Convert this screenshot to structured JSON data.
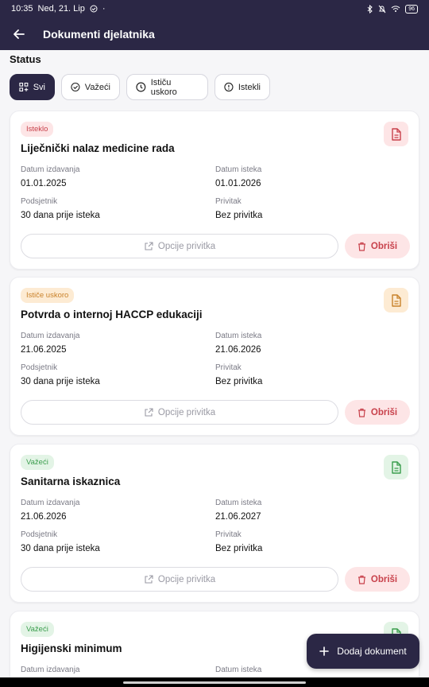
{
  "status_bar": {
    "time": "10:35",
    "date": "Ned, 21. Lip",
    "battery": "96"
  },
  "header": {
    "title": "Dokumenti djelatnika"
  },
  "status_section": {
    "title": "Status"
  },
  "filters": [
    {
      "label": "Svi"
    },
    {
      "label": "Važeći"
    },
    {
      "label": "Ističu uskoro"
    },
    {
      "label": "Istekli"
    }
  ],
  "labels": {
    "issue_date": "Datum izdavanja",
    "expiry_date": "Datum isteka",
    "reminder": "Podsjetnik",
    "attachment": "Privitak",
    "options": "Opcije privitka",
    "delete": "Obriši"
  },
  "documents": [
    {
      "status": "Isteklo",
      "title": "Liječnički nalaz medicine rada",
      "issue_date": "01.01.2025",
      "expiry_date": "01.01.2026",
      "reminder": "30 dana prije isteka",
      "attachment": "Bez privitka"
    },
    {
      "status": "Ističe uskoro",
      "title": "Potvrda o internoj HACCP edukaciji",
      "issue_date": "21.06.2025",
      "expiry_date": "21.06.2026",
      "reminder": "30 dana prije isteka",
      "attachment": "Bez privitka"
    },
    {
      "status": "Važeći",
      "title": "Sanitarna iskaznica",
      "issue_date": "21.06.2026",
      "expiry_date": "21.06.2027",
      "reminder": "30 dana prije isteka",
      "attachment": "Bez privitka"
    },
    {
      "status": "Važeći",
      "title": "Higijenski minimum"
    }
  ],
  "fab": {
    "label": "Dodaj dokument"
  },
  "colors": {
    "primary": "#2b2745",
    "expired": "#c8414b",
    "expiring": "#c9822b",
    "valid": "#3a9d4d"
  }
}
